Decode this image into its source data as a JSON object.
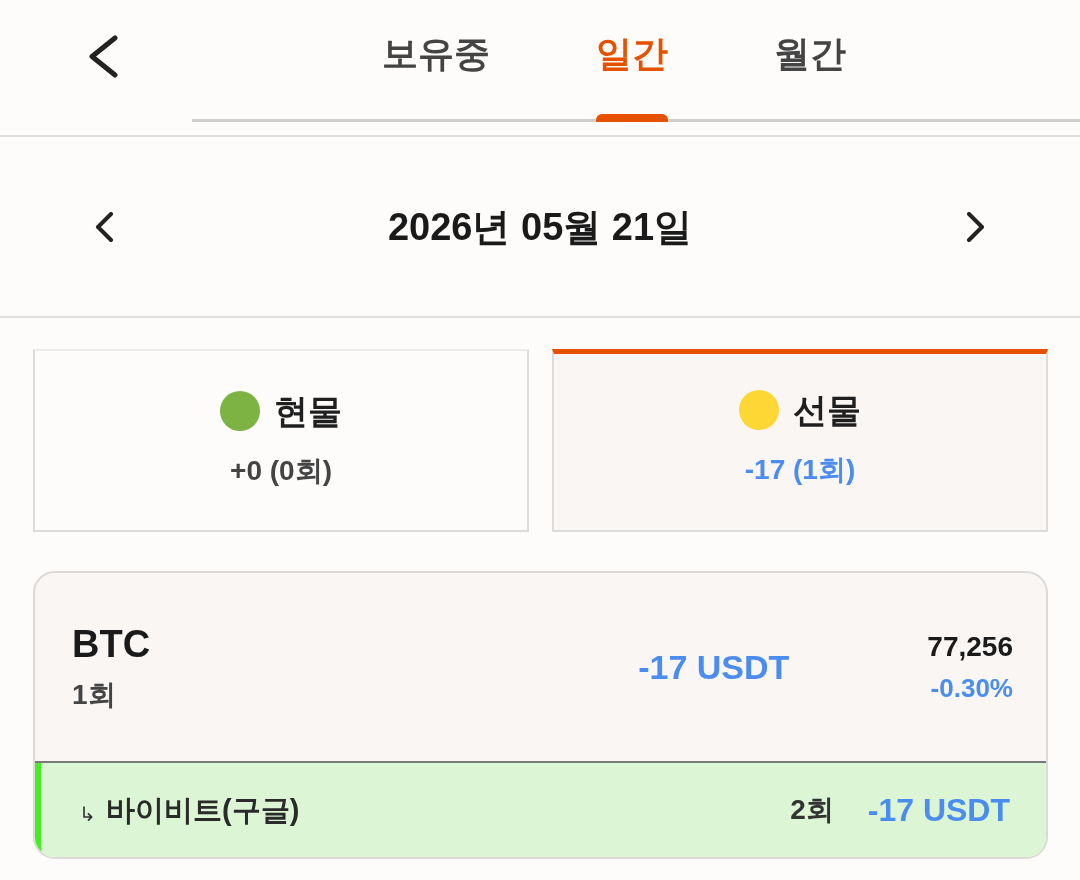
{
  "header": {
    "tabs": [
      {
        "label": "보유중",
        "selected": false
      },
      {
        "label": "일간",
        "selected": true
      },
      {
        "label": "월간",
        "selected": false
      }
    ]
  },
  "date_nav": {
    "date": "2026년 05월 21일"
  },
  "markets": [
    {
      "label": "현물",
      "summary": "+0 (0회)",
      "negative": false,
      "color": "#7cb342",
      "selected": false
    },
    {
      "label": "선물",
      "summary": "-17 (1회)",
      "negative": true,
      "color": "#fdd835",
      "selected": true
    }
  ],
  "positions": [
    {
      "symbol": "BTC",
      "count": "1회",
      "pnl": "-17 USDT",
      "pnl_negative": true,
      "price": "77,256",
      "change": "-0.30%",
      "change_negative": true,
      "accounts": [
        {
          "marker": "↳",
          "name": "바이비트(구글)",
          "count": "2회",
          "pnl": "-17 USDT",
          "negative": true
        }
      ]
    }
  ]
}
